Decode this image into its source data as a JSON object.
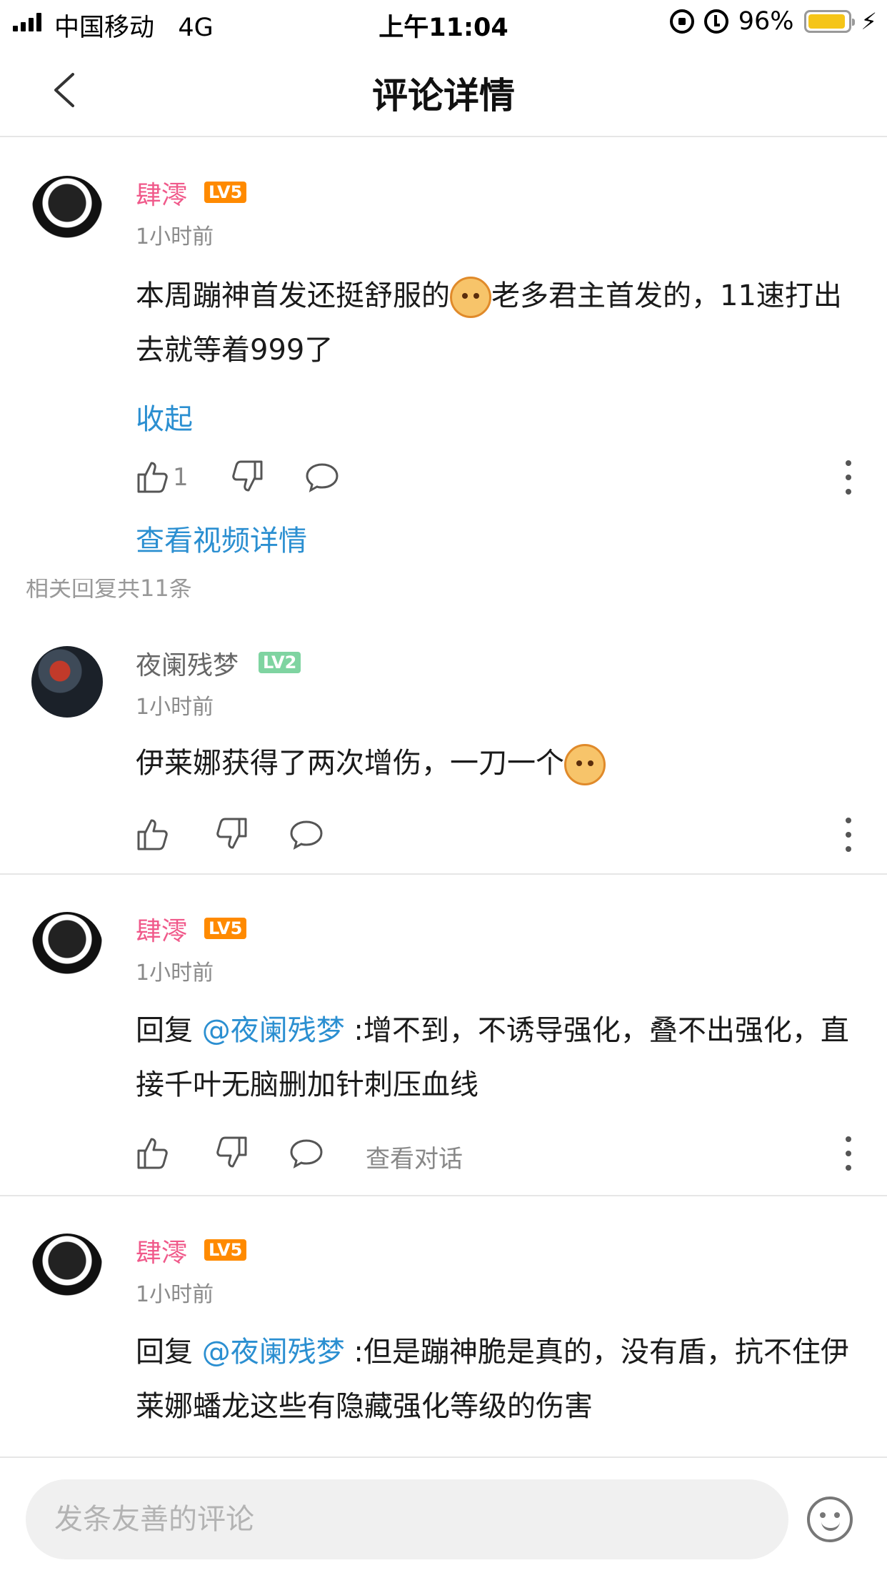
{
  "status_bar": {
    "carrier": "中国移动",
    "network": "4G",
    "time": "上午11:04",
    "battery": "96%",
    "battery_level": 0.96
  },
  "header": {
    "title": "评论详情"
  },
  "main_comment": {
    "username": "肆澪",
    "level": "LV5",
    "time": "1小时前",
    "text_part1": "本周蹦神首发还挺舒服的",
    "text_part2": "老多君主首发的，11速打出去就等着999了",
    "collapse_label": "收起",
    "like_count": "1",
    "view_video_label": "查看视频详情"
  },
  "related_replies_label": "相关回复共11条",
  "replies": [
    {
      "username": "夜阑残梦",
      "level": "LV2",
      "time": "1小时前",
      "text": "伊莱娜获得了两次增伤，一刀一个"
    },
    {
      "username": "肆澪",
      "level": "LV5",
      "time": "1小时前",
      "reply_prefix": "回复 ",
      "mention": "@夜阑残梦",
      "text": " :增不到，不诱导强化，叠不出强化，直接千叶无脑删加针刺压血线",
      "view_conversation_label": "查看对话"
    },
    {
      "username": "肆澪",
      "level": "LV5",
      "time": "1小时前",
      "reply_prefix": "回复 ",
      "mention": "@夜阑残梦",
      "text": " :但是蹦神脆是真的，没有盾，抗不住伊莱娜蟠龙这些有隐藏强化等级的伤害"
    }
  ],
  "bottom_bar": {
    "input_placeholder": "发条友善的评论"
  },
  "colors": {
    "username_pink": "#f0598a",
    "link_blue": "#2b8fd1",
    "level_orange": "#ff8a00",
    "level_green": "#7fd4a1"
  }
}
